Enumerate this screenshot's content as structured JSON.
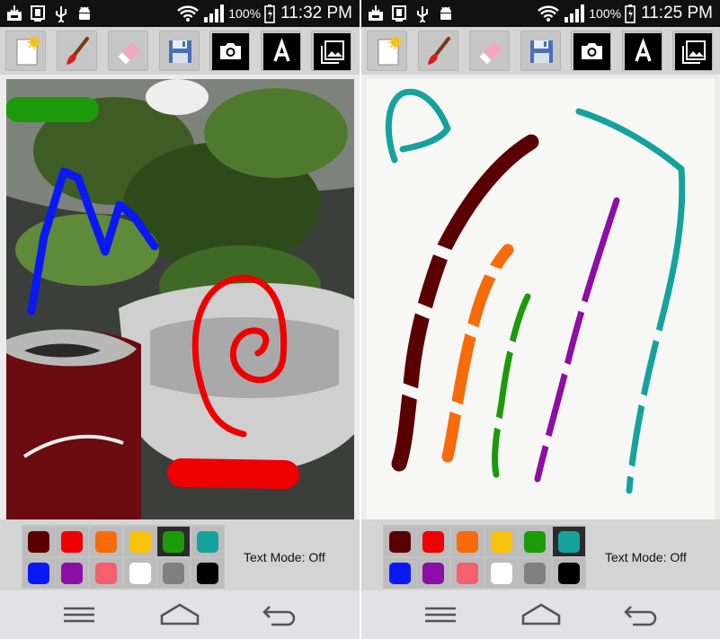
{
  "screens": [
    {
      "status": {
        "battery": "100%",
        "time": "11:32 PM"
      },
      "text_mode_label": "Text Mode: Off",
      "selected_color": "green"
    },
    {
      "status": {
        "battery": "100%",
        "time": "11:25 PM"
      },
      "text_mode_label": "Text Mode: Off",
      "selected_color": "teal"
    }
  ],
  "toolbar_tools": [
    {
      "name": "new-canvas",
      "icon": "new-document-icon"
    },
    {
      "name": "brush",
      "icon": "paintbrush-icon"
    },
    {
      "name": "eraser",
      "icon": "eraser-icon"
    },
    {
      "name": "save",
      "icon": "floppy-disk-icon"
    },
    {
      "name": "camera",
      "icon": "camera-icon"
    },
    {
      "name": "text",
      "icon": "text-a-icon"
    },
    {
      "name": "gallery",
      "icon": "gallery-icon"
    }
  ],
  "palette": [
    {
      "name": "maroon",
      "hex": "#5a0000"
    },
    {
      "name": "red",
      "hex": "#ee0000"
    },
    {
      "name": "orange",
      "hex": "#f86b0a"
    },
    {
      "name": "yellow",
      "hex": "#f8c10a"
    },
    {
      "name": "green",
      "hex": "#1c9a09"
    },
    {
      "name": "teal",
      "hex": "#16a29c"
    },
    {
      "name": "blue",
      "hex": "#0a18f4"
    },
    {
      "name": "purple",
      "hex": "#8d0ea4"
    },
    {
      "name": "pink",
      "hex": "#f4606e"
    },
    {
      "name": "white",
      "hex": "#ffffff"
    },
    {
      "name": "gray",
      "hex": "#808080"
    },
    {
      "name": "black",
      "hex": "#000000"
    }
  ],
  "nav_buttons": [
    "menu-icon",
    "home-icon",
    "back-icon"
  ],
  "stroke_colors": {
    "left": [
      "green",
      "blue",
      "red",
      "red"
    ],
    "right": [
      "teal",
      "maroon",
      "orange",
      "green",
      "purple",
      "teal"
    ]
  }
}
